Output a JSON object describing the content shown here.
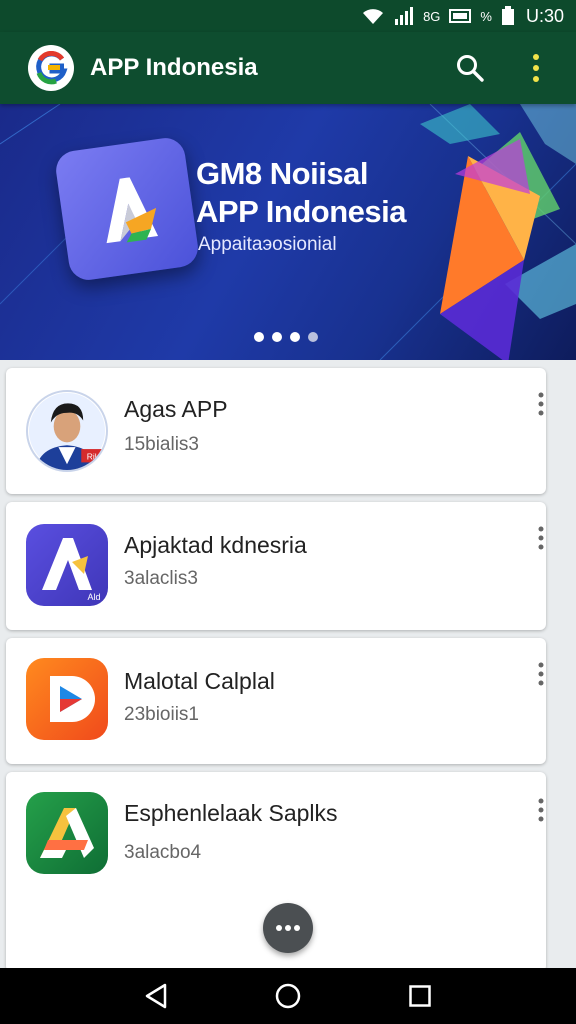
{
  "status_bar": {
    "time": "U:30",
    "network_label": "8G",
    "data_label": "%",
    "icons": [
      "wifi-icon",
      "signal-icon",
      "network-icon",
      "battery-icon"
    ]
  },
  "app_bar": {
    "title": "APP Indonesia",
    "actions": [
      "search-icon",
      "more-vert-icon"
    ],
    "background": "#0e4d2f",
    "more_color": "#f2e34a"
  },
  "banner": {
    "line1": "GM8 Noiisal",
    "line2": "APP Indonesia",
    "line3": "Appaitaэosionial",
    "page_count": 4,
    "active_page": 0
  },
  "apps": [
    {
      "title": "Agas APP",
      "subtitle": "15bialis3",
      "icon": "user-avatar-icon",
      "badge": "Ril"
    },
    {
      "title": "Apjaktad kdnesria",
      "subtitle": "3alaclis3",
      "icon": "purple-a-app-icon",
      "badge": "Ald"
    },
    {
      "title": "Malotal Calplal",
      "subtitle": "23bioiis1",
      "icon": "orange-play-app-icon"
    },
    {
      "title": "Esphenlelaak Saplks",
      "subtitle": "3alacbo4",
      "icon": "green-a-app-icon"
    }
  ],
  "fab": {
    "icon": "more-horiz-icon"
  },
  "nav_bar": {
    "buttons": [
      "back-icon",
      "home-icon",
      "recents-icon"
    ]
  }
}
